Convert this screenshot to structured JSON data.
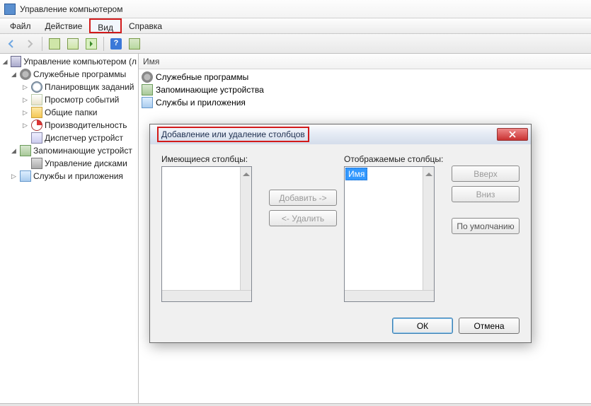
{
  "window": {
    "title": "Управление компьютером"
  },
  "menu": {
    "file": "Файл",
    "action": "Действие",
    "view": "Вид",
    "help": "Справка"
  },
  "tree": {
    "root": "Управление компьютером (л",
    "sys_tools": "Служебные программы",
    "scheduler": "Планировщик заданий",
    "events": "Просмотр событий",
    "shared": "Общие папки",
    "perf": "Производительность",
    "devmgr": "Диспетчер устройст",
    "storage": "Запоминающие устройст",
    "diskmgmt": "Управление дисками",
    "services": "Службы и приложения"
  },
  "column": {
    "name": "Имя"
  },
  "list": {
    "i0": "Служебные программы",
    "i1": "Запоминающие устройства",
    "i2": "Службы и приложения"
  },
  "dialog": {
    "title": "Добавление или удаление столбцов",
    "available_label": "Имеющиеся столбцы:",
    "displayed_label": "Отображаемые столбцы:",
    "displayed_item": "Имя",
    "add": "Добавить ->",
    "remove": "<- Удалить",
    "up": "Вверх",
    "down": "Вниз",
    "reset": "По умолчанию",
    "ok": "ОК",
    "cancel": "Отмена"
  }
}
